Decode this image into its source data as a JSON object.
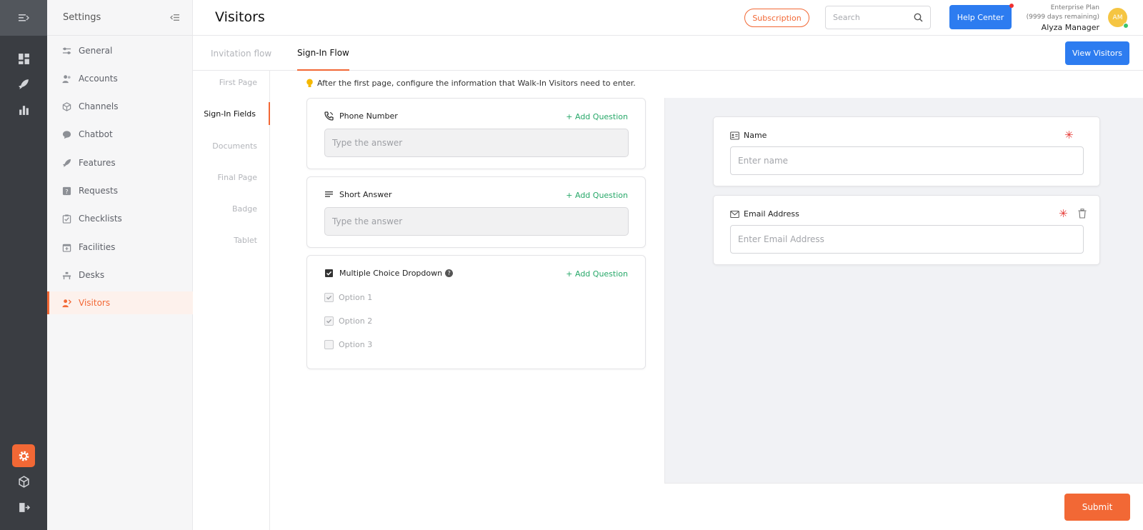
{
  "app": {
    "accent": "#f26835",
    "primary": "#2d7cf0",
    "success": "#27a869"
  },
  "rail": {
    "items": [
      {
        "icon": "menu-collapse-icon"
      },
      {
        "icon": "dashboard-icon"
      },
      {
        "icon": "rocket-icon"
      },
      {
        "icon": "analytics-icon"
      },
      {
        "icon": "settings-gear-icon"
      },
      {
        "icon": "package-icon"
      },
      {
        "icon": "logout-icon"
      }
    ]
  },
  "settings": {
    "title": "Settings",
    "items": [
      {
        "label": "General",
        "icon": "sliders-icon"
      },
      {
        "label": "Accounts",
        "icon": "users-icon"
      },
      {
        "label": "Channels",
        "icon": "cube-icon"
      },
      {
        "label": "Chatbot",
        "icon": "chat-bubble-icon"
      },
      {
        "label": "Features",
        "icon": "rocket-icon"
      },
      {
        "label": "Requests",
        "icon": "question-square-icon"
      },
      {
        "label": "Checklists",
        "icon": "checklist-icon"
      },
      {
        "label": "Facilities",
        "icon": "calendar-plus-icon"
      },
      {
        "label": "Desks",
        "icon": "desk-icon"
      },
      {
        "label": "Visitors",
        "icon": "visitor-icon"
      }
    ]
  },
  "header": {
    "title": "Visitors",
    "subscription_label": "Subscription",
    "search_placeholder": "Search",
    "help_label": "Help Center",
    "plan_name": "Enterprise Plan",
    "plan_remaining": "(9999 days remaining)",
    "user_name": "Alyza Manager",
    "avatar_initials": "AM"
  },
  "tabs": {
    "items": [
      "Invitation flow",
      "Sign-In Flow"
    ],
    "view_visitors_label": "View Visitors"
  },
  "subnav": {
    "items": [
      "First Page",
      "Sign-In Fields",
      "Documents",
      "Final Page",
      "Badge",
      "Tablet"
    ]
  },
  "hint": "After the first page, configure the information that Walk-In Visitors need to enter.",
  "questions": {
    "add_label": "+ Add Question",
    "phone": {
      "title": "Phone Number",
      "placeholder": "Type the answer"
    },
    "short": {
      "title": "Short Answer",
      "placeholder": "Type the answer"
    },
    "multi": {
      "title": "Multiple Choice Dropdown",
      "options": [
        "Option 1",
        "Option 2",
        "Option 3"
      ]
    }
  },
  "preview": {
    "name": {
      "label": "Name",
      "placeholder": "Enter name",
      "required_mark": "✳"
    },
    "email": {
      "label": "Email Address",
      "placeholder": "Enter Email Address",
      "required_mark": "✳"
    },
    "submit_label": "Submit"
  }
}
